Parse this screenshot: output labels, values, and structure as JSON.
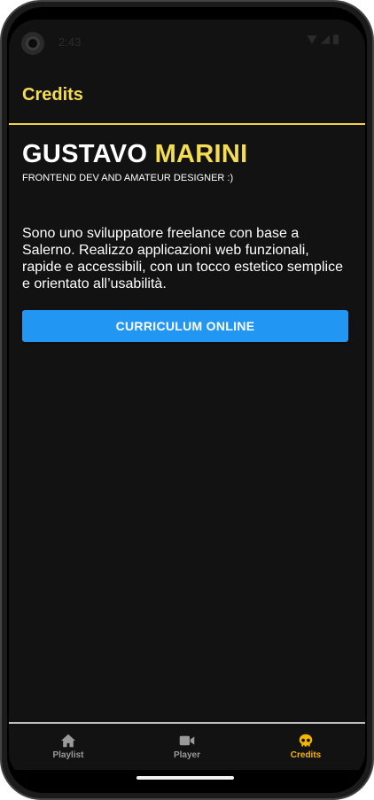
{
  "status_bar": {
    "time": "2:43"
  },
  "header": {
    "title": "Credits"
  },
  "profile": {
    "first_name": "GUSTAVO",
    "last_name": "MARINI",
    "tagline": "FRONTEND DEV AND AMATEUR DESIGNER :)",
    "bio": "Sono uno sviluppatore freelance con base a Salerno. Realizzo applicazioni web funzionali, rapide e accessibili, con un tocco estetico semplice e orientato all’usabilità.",
    "cv_button_label": "CURRICULUM ONLINE"
  },
  "tabs": [
    {
      "label": "Playlist",
      "icon": "home-icon",
      "active": false
    },
    {
      "label": "Player",
      "icon": "video-camera-icon",
      "active": false
    },
    {
      "label": "Credits",
      "icon": "skull-icon",
      "active": true
    }
  ],
  "colors": {
    "accent": "#f5dd52",
    "active_tab": "#f5b400",
    "button": "#2196f3",
    "background": "#121212"
  }
}
